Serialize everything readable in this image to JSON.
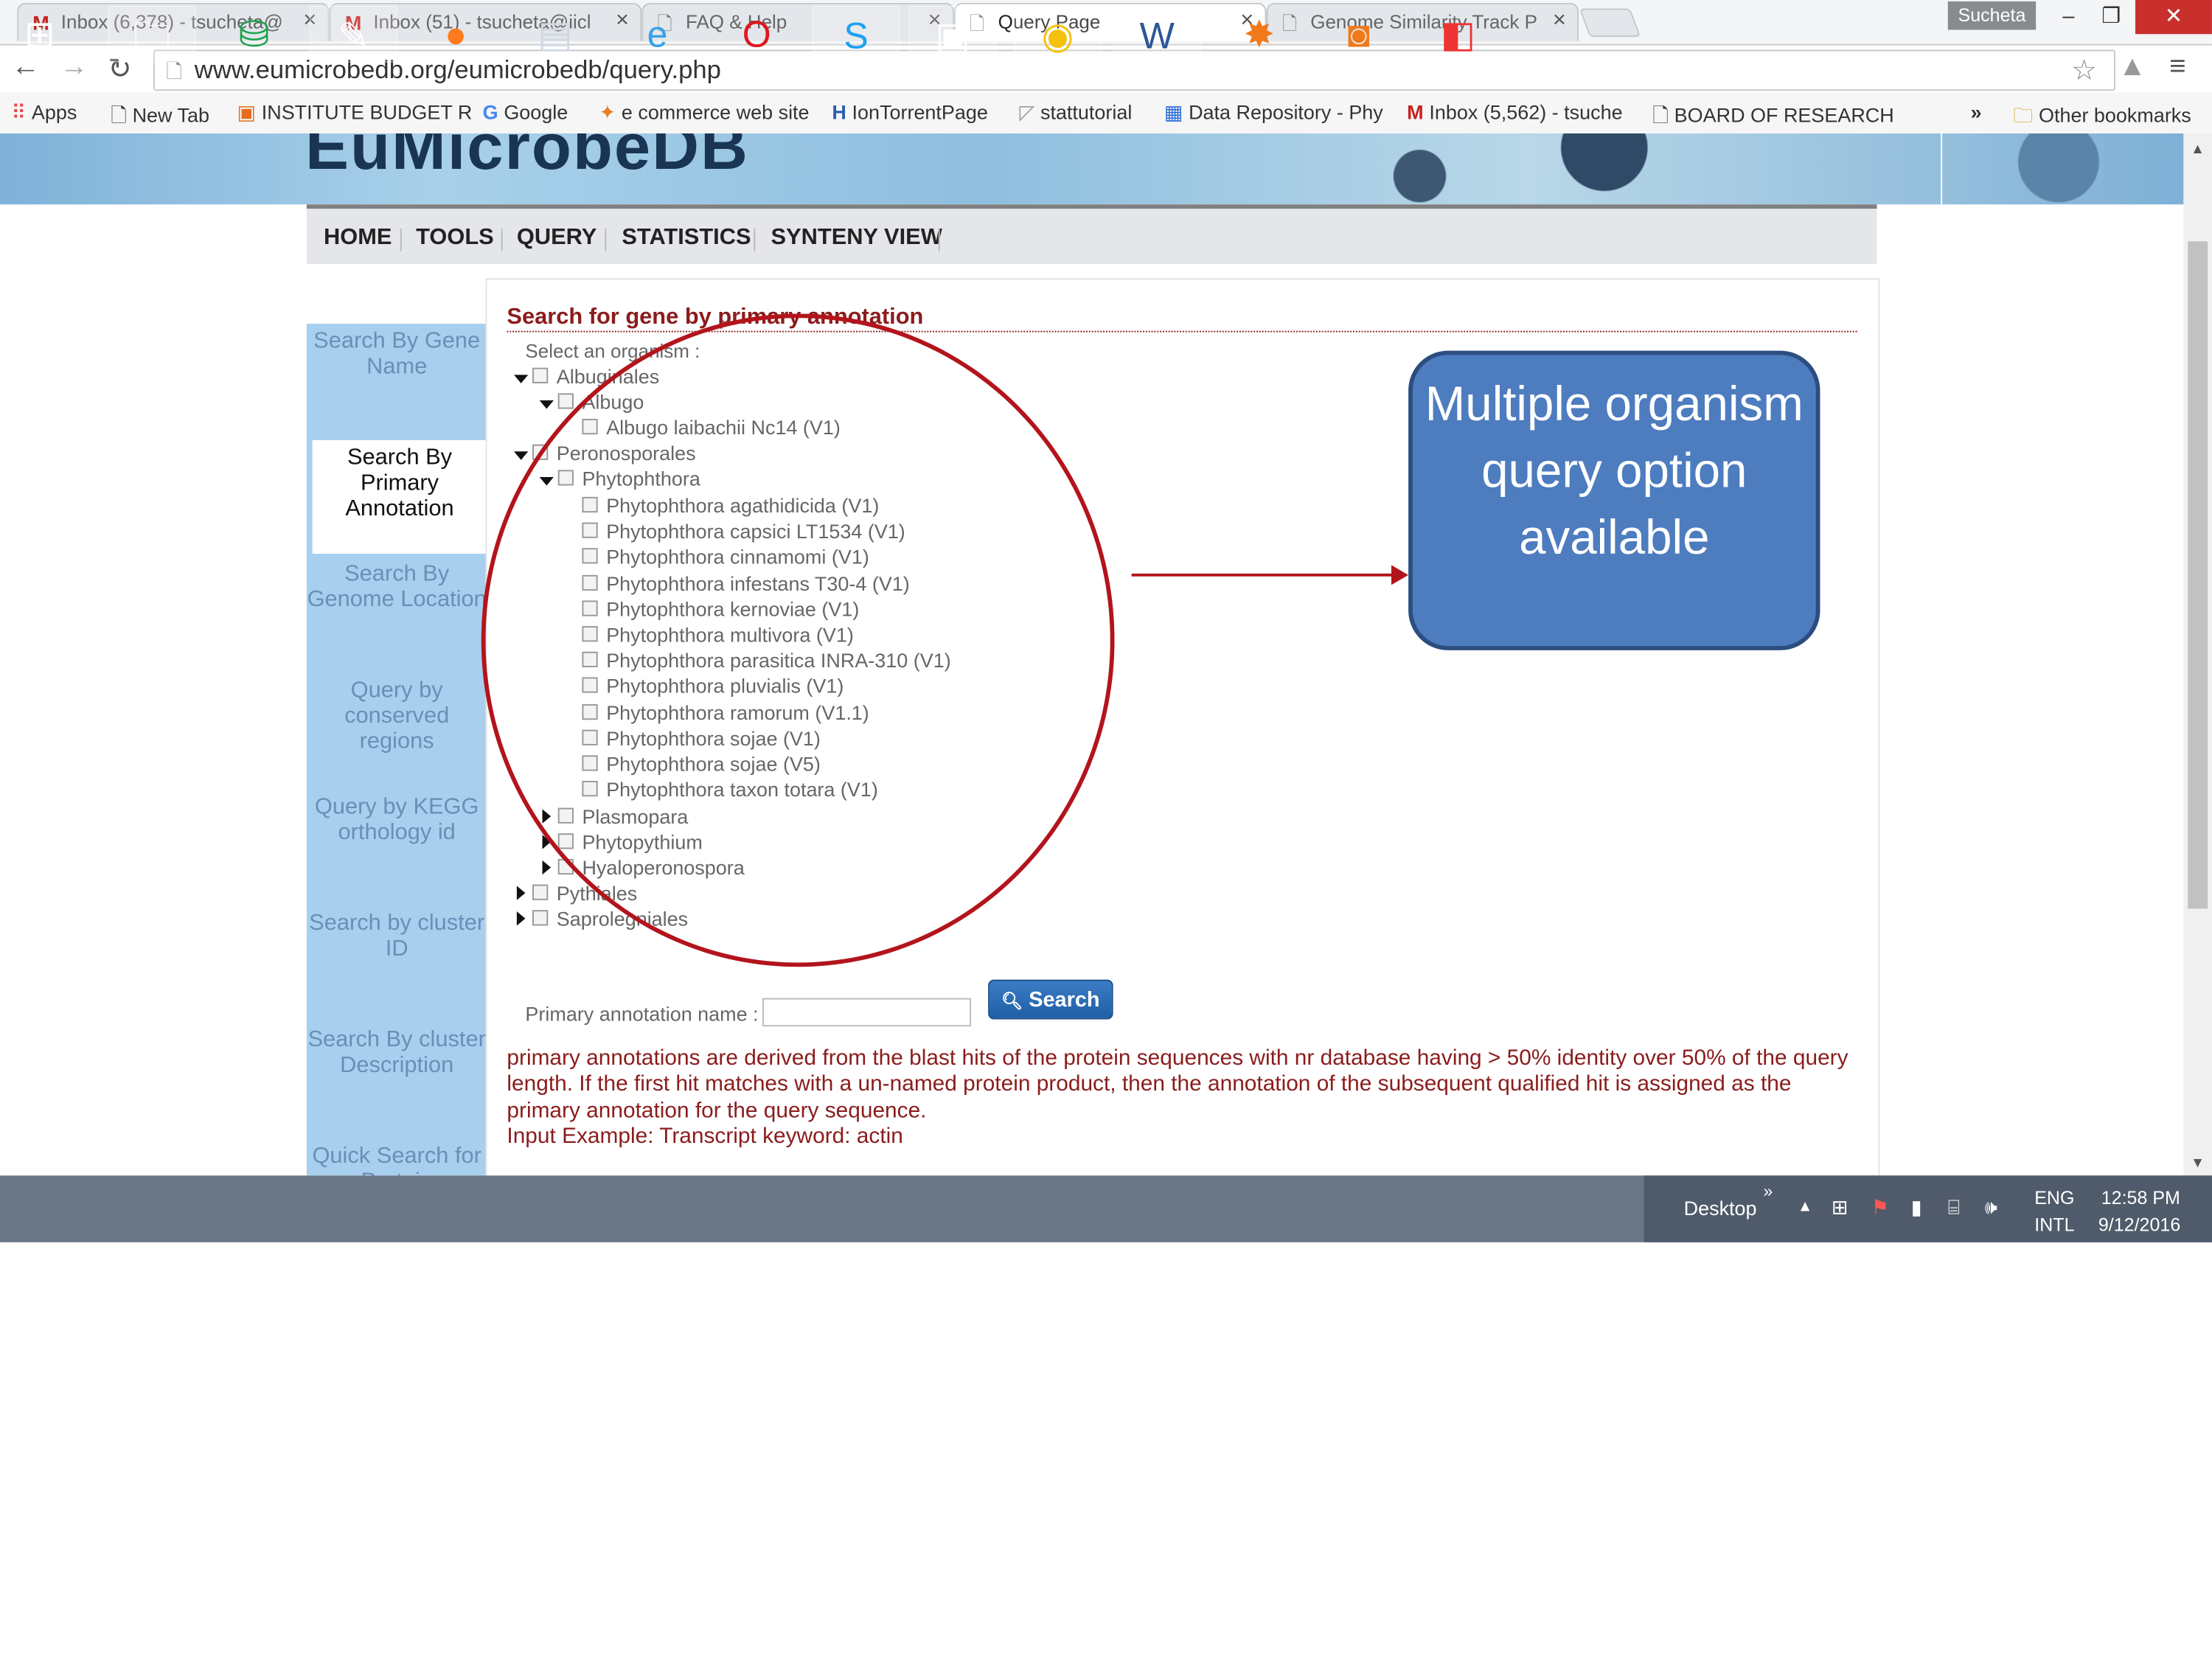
{
  "browser": {
    "tabs": [
      {
        "label": "Inbox (6,378) - tsucheta@",
        "icon": "gmail-icon"
      },
      {
        "label": "Inbox (51) - tsucheta@iicl",
        "icon": "gmail-icon"
      },
      {
        "label": "FAQ & Help",
        "icon": "page-icon"
      },
      {
        "label": "Query Page",
        "icon": "page-icon",
        "active": true
      },
      {
        "label": "Genome Similarity Track P",
        "icon": "page-icon"
      }
    ],
    "user": "Sucheta",
    "url": "www.eumicrobedb.org/eumicrobedb/query.php",
    "bookmarks": [
      {
        "label": "Apps"
      },
      {
        "label": "New Tab"
      },
      {
        "label": "INSTITUTE BUDGET R"
      },
      {
        "label": "Google"
      },
      {
        "label": "e commerce web site"
      },
      {
        "label": "IonTorrentPage"
      },
      {
        "label": "stattutorial"
      },
      {
        "label": "Data Repository - Phy"
      },
      {
        "label": "Inbox (5,562) - tsuche"
      },
      {
        "label": "BOARD OF RESEARCH"
      }
    ],
    "bookmarks_more": "»",
    "other_bookmarks": "Other bookmarks"
  },
  "site": {
    "logo": "EuMicrobeDB",
    "nav": [
      "HOME",
      "TOOLS",
      "QUERY",
      "STATISTICS",
      "SYNTENY VIEW"
    ],
    "sidebar": [
      "Search By Gene Name",
      "Search By Primary Annotation",
      "Search By Genome Location",
      "Query by conserved regions",
      "Query by KEGG orthology id",
      "Search by cluster ID",
      "Search By cluster Description",
      "Quick Search for Protein"
    ]
  },
  "form": {
    "title": "Search for gene by primary annotation",
    "select_label": "Select an organism :",
    "tree": {
      "albuginales": "Albuginales",
      "albugo": "Albugo",
      "albugo_species": "Albugo laibachii Nc14 (V1)",
      "peronosporales": "Peronosporales",
      "phytophthora": "Phytophthora",
      "phytophthora_species": [
        "Phytophthora agathidicida (V1)",
        "Phytophthora capsici LT1534 (V1)",
        "Phytophthora cinnamomi (V1)",
        "Phytophthora infestans T30-4 (V1)",
        "Phytophthora kernoviae (V1)",
        "Phytophthora multivora (V1)",
        "Phytophthora parasitica INRA-310 (V1)",
        "Phytophthora pluvialis (V1)",
        "Phytophthora ramorum (V1.1)",
        "Phytophthora sojae (V1)",
        "Phytophthora sojae (V5)",
        "Phytophthora taxon totara (V1)"
      ],
      "plasmopara": "Plasmopara",
      "phytopythium": "Phytopythium",
      "hyaloperonospora": "Hyaloperonospora",
      "pythiales": "Pythiales",
      "saprolegniales": "Saprolegniales"
    },
    "annotation_label": "Primary annotation name :",
    "annotation_value": "",
    "search_button": "Search",
    "description": "primary annotations are derived from the blast hits of the protein sequences with nr database having > 50% identity over 50% of the query length. If the first hit matches with a un-named protein product, then the annotation of the subsequent qualified hit is assigned as the primary annotation for the query sequence.",
    "example": "Input Example: Transcript keyword: actin"
  },
  "callout": {
    "text": "Multiple organism query option available",
    "color": "#4d7cbf",
    "ring_color": "#b3141c"
  },
  "taskbar": {
    "desktop_label": "Desktop",
    "lang": "ENG",
    "layout": "INTL",
    "time": "12:58 PM",
    "date": "9/12/2016"
  }
}
